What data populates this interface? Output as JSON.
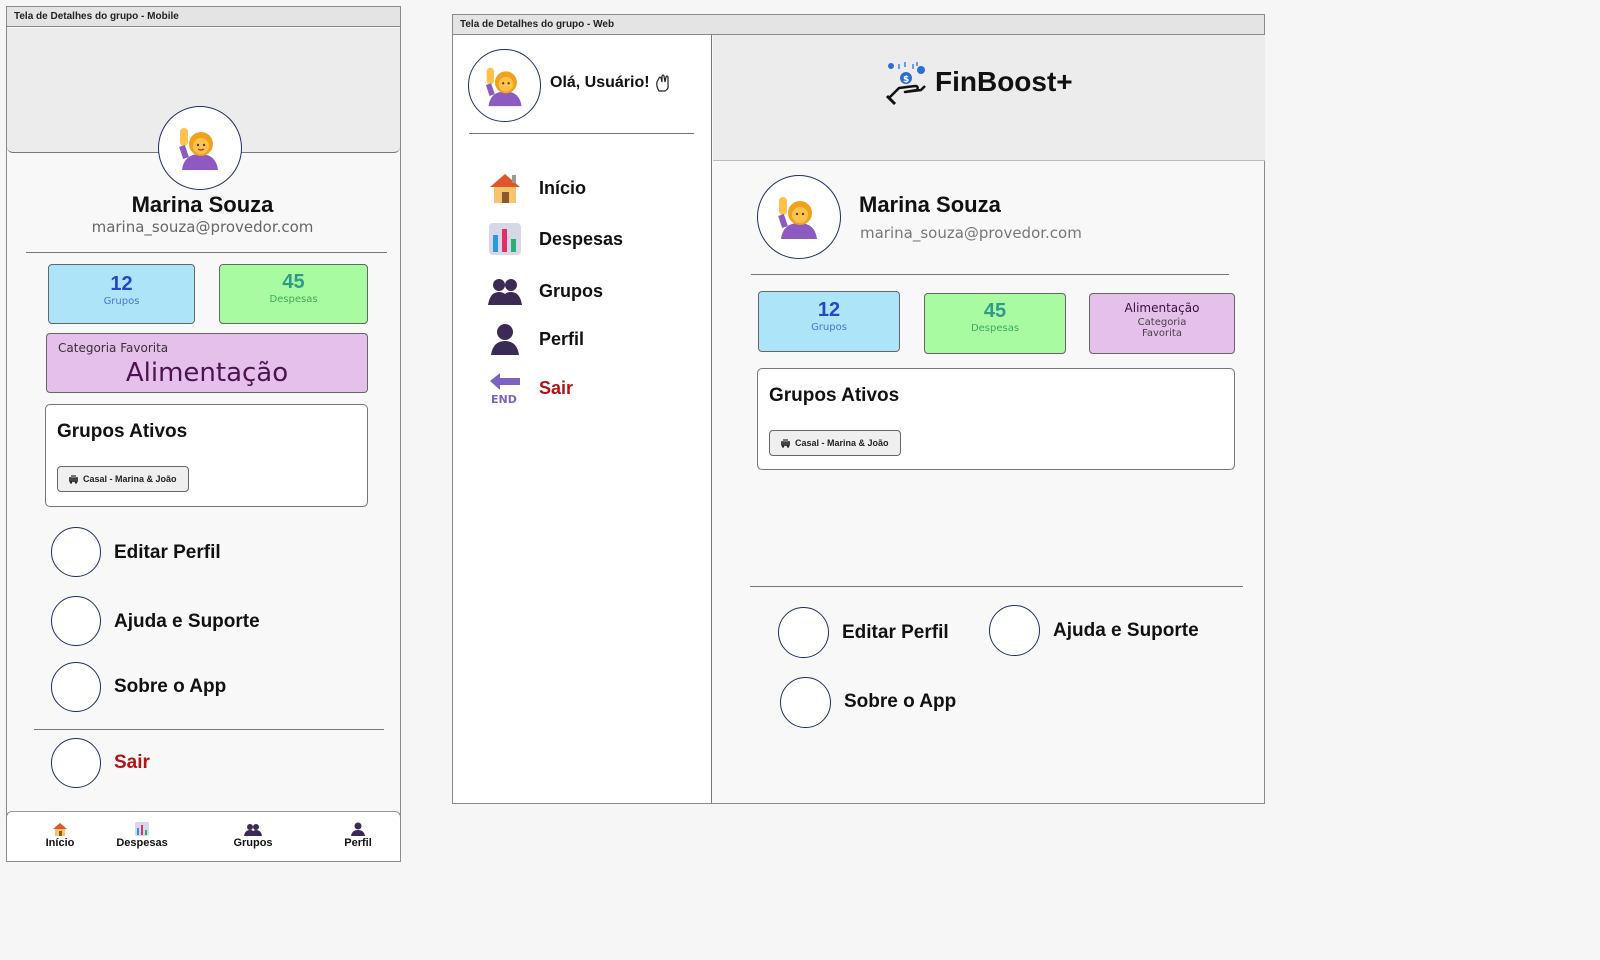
{
  "mobile": {
    "frame_title": "Tela de Detalhes do grupo - Mobile",
    "user": {
      "name": "Marina Souza",
      "email": "marina_souza@provedor.com"
    },
    "stats": {
      "groups": {
        "value": "12",
        "label": "Grupos"
      },
      "expenses": {
        "value": "45",
        "label": "Despesas"
      }
    },
    "favorite": {
      "label": "Categoria Favorita",
      "value": "Alimentação"
    },
    "active_groups": {
      "title": "Grupos Ativos",
      "chip": "Casal - Marina & João"
    },
    "actions": {
      "edit": "Editar Perfil",
      "help": "Ajuda e Suporte",
      "about": "Sobre o App",
      "logout": "Sair"
    },
    "bottom_nav": [
      "Início",
      "Despesas",
      "Grupos",
      "Perfil"
    ]
  },
  "web": {
    "frame_title": "Tela de Detalhes do grupo - Web",
    "greeting": "Olá, Usuário!",
    "brand": "FinBoost+",
    "sidebar": [
      "Início",
      "Despesas",
      "Grupos",
      "Perfil",
      "Sair"
    ],
    "user": {
      "name": "Marina Souza",
      "email": "marina_souza@provedor.com"
    },
    "stats": {
      "groups": {
        "value": "12",
        "label": "Grupos"
      },
      "expenses": {
        "value": "45",
        "label": "Despesas"
      },
      "favorite": {
        "value": "Alimentação",
        "label_line1": "Categoria",
        "label_line2": "Favorita"
      }
    },
    "active_groups": {
      "title": "Grupos Ativos",
      "chip": "Casal - Marina & João"
    },
    "actions": {
      "edit": "Editar Perfil",
      "help": "Ajuda e Suporte",
      "about": "Sobre o App"
    }
  },
  "colors": {
    "accent_border": "#1e2d66",
    "logout_red": "#b31313",
    "card_blue": "#aee4f8",
    "card_green": "#a8fba0",
    "card_purple": "#e5c0ea"
  },
  "icons": [
    "waving-woman-icon",
    "house-icon",
    "bar-chart-icon",
    "users-icon",
    "user-icon",
    "end-arrow-icon",
    "waving-hand-icon",
    "car-icon",
    "money-hand-icon"
  ]
}
